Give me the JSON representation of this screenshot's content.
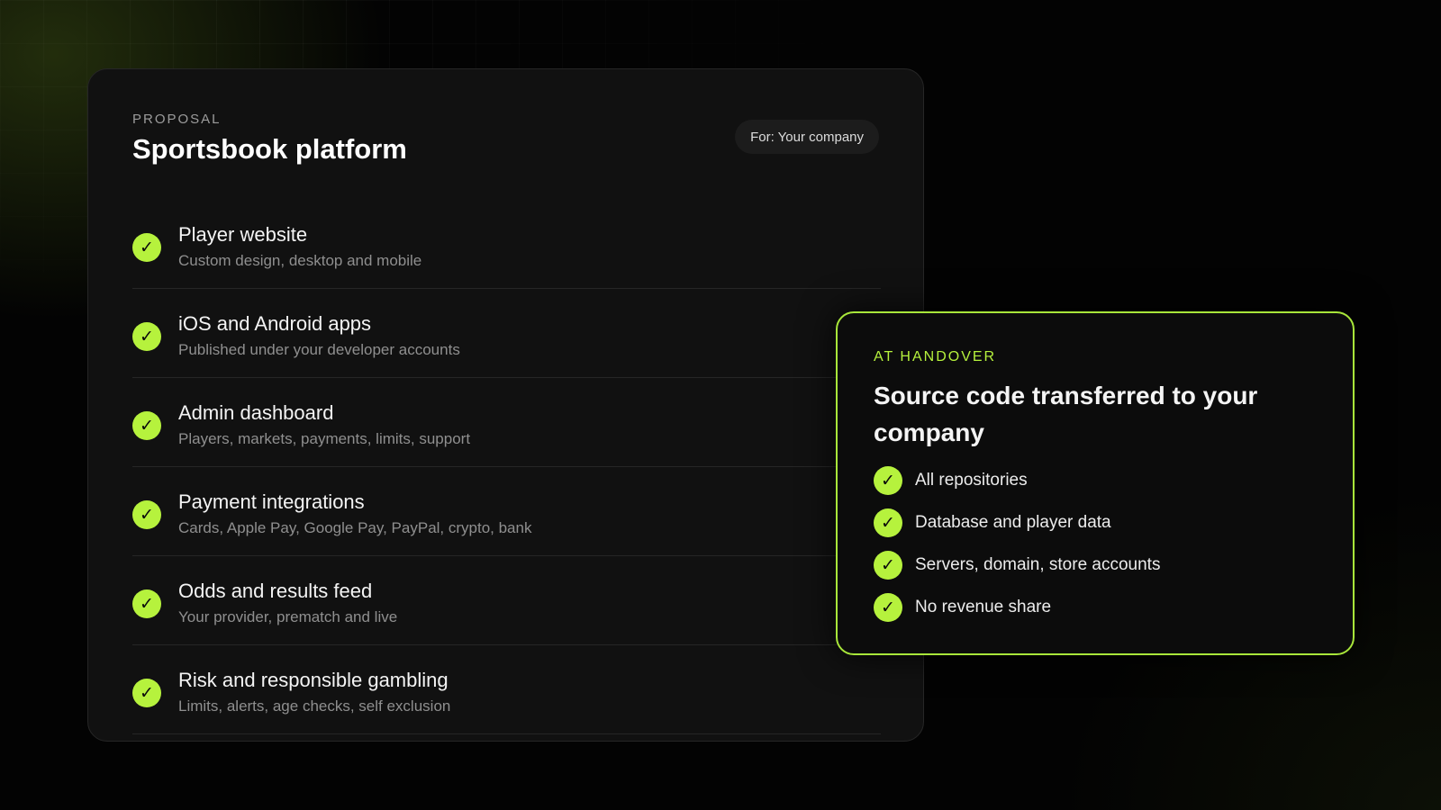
{
  "proposal": {
    "eyebrow": "PROPOSAL",
    "title": "Sportsbook platform",
    "badge": "For: Your company",
    "check_icon": "✓",
    "items": [
      {
        "title": "Player website",
        "subtitle": "Custom design, desktop and mobile"
      },
      {
        "title": "iOS and Android apps",
        "subtitle": "Published under your developer accounts"
      },
      {
        "title": "Admin dashboard",
        "subtitle": "Players, markets, payments, limits, support"
      },
      {
        "title": "Payment integrations",
        "subtitle": "Cards, Apple Pay, Google Pay, PayPal, crypto, bank"
      },
      {
        "title": "Odds and results feed",
        "subtitle": "Your provider, prematch and live"
      },
      {
        "title": "Risk and responsible gambling",
        "subtitle": "Limits, alerts, age checks, self exclusion"
      }
    ]
  },
  "handover": {
    "eyebrow": "AT HANDOVER",
    "title": "Source code transferred to your company",
    "items": [
      {
        "label": "All repositories"
      },
      {
        "label": "Database and player data"
      },
      {
        "label": "Servers, domain, store accounts"
      },
      {
        "label": "No revenue share"
      }
    ]
  },
  "theme": {
    "accent": "#b6f23d",
    "card_bg": "#111111",
    "page_bg": "#030303"
  }
}
